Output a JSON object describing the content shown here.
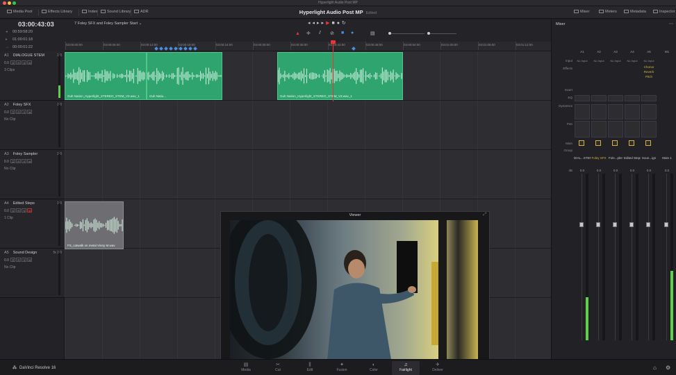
{
  "window": {
    "title": "Hyperlight Audio Post MP"
  },
  "toolbar": {
    "left_items": [
      {
        "label": "Media Pool",
        "icon": "media-pool-icon"
      },
      {
        "label": "Effects Library",
        "icon": "effects-icon"
      },
      {
        "label": "Index",
        "icon": "index-icon"
      },
      {
        "label": "Sound Library",
        "icon": "sound-library-icon"
      },
      {
        "label": "ADR",
        "icon": "adr-icon"
      }
    ],
    "project_title": "Hyperlight Audio Post MP",
    "project_status": "Edited",
    "right_items": [
      {
        "label": "Mixer",
        "icon": "mixer-icon"
      },
      {
        "label": "Meters",
        "icon": "meters-icon"
      },
      {
        "label": "Metadata",
        "icon": "metadata-icon"
      },
      {
        "label": "Inspector",
        "icon": "inspector-icon"
      }
    ]
  },
  "timecode": {
    "main": "03:00:43:03",
    "rows": [
      {
        "label": "IN",
        "value": "00:59:58:20"
      },
      {
        "label": "OUT",
        "value": "01:00:01:18"
      },
      {
        "label": "DUR",
        "value": "00:00:01:22"
      }
    ]
  },
  "timeline": {
    "name": "7 Foley SFX and Foley Sampler Start",
    "ruler_ticks": [
      "03:00:00:00",
      "03:00:06:00",
      "03:00:12:00",
      "03:00:18:00",
      "03:00:24:00",
      "03:00:30:00",
      "03:00:36:00",
      "03:00:42:00",
      "03:00:48:00",
      "03:00:54:00",
      "03:01:00:00",
      "03:01:06:00",
      "03:01:12:00"
    ]
  },
  "tracks": [
    {
      "id": "A1",
      "name": "DIALOGUE STEM",
      "volume": "1.0",
      "level": "0.0",
      "clips": "3 Clips"
    },
    {
      "id": "A2",
      "name": "Foley SFX",
      "volume": "1.0",
      "level": "0.0",
      "clips": "No Clip"
    },
    {
      "id": "A3",
      "name": "Foley Sampler",
      "volume": "1.0",
      "level": "0.0",
      "clips": "No Clip"
    },
    {
      "id": "A4",
      "name": "Edited Steps",
      "volume": "1.0",
      "level": "0.0",
      "clips": "1 Clip"
    },
    {
      "id": "A5",
      "name": "Sound Design",
      "fx": "fx",
      "volume": "1.0",
      "level": "0.0",
      "clips": "No Clip"
    }
  ],
  "clips": {
    "a1_1": "Guh Nation_Hyperlight_STEREO_STEM_V3.wav_1",
    "a1_2": "Guh Natio...",
    "a1_3": "Guh Nation_Hyperlight_STEREO_STEM_V3.wav_1",
    "a4_1": "FS_catwalk on metal Vinny M.wav"
  },
  "viewer": {
    "title": "Viewer"
  },
  "mixer": {
    "title": "Mixer",
    "columns": [
      "A1",
      "A2",
      "A3",
      "A4",
      "A5",
      "M1"
    ],
    "input_values": [
      "No Input",
      "No Input",
      "No Input",
      "No Input",
      "No Input"
    ],
    "effects_a5": [
      "Chorus",
      "Reverb",
      "Pitch"
    ],
    "row_labels": [
      "Input",
      "Effects",
      "Insert",
      "EQ",
      "Dynamics",
      "Pan",
      "Main",
      "Group"
    ],
    "strip_names": [
      "DIAL...STEM",
      "Foley SFX",
      "Fole...pler",
      "Edited Steps",
      "Soun...ign",
      "Main 1"
    ],
    "levels": [
      "0.0",
      "0.0",
      "0.0",
      "0.0",
      "0.0",
      "0.0"
    ],
    "bus_label": "dB"
  },
  "pages": [
    {
      "label": "Media",
      "icon": "media-page-icon"
    },
    {
      "label": "Cut",
      "icon": "cut-page-icon"
    },
    {
      "label": "Edit",
      "icon": "edit-page-icon"
    },
    {
      "label": "Fusion",
      "icon": "fusion-page-icon"
    },
    {
      "label": "Color",
      "icon": "color-page-icon"
    },
    {
      "label": "Fairlight",
      "icon": "fairlight-page-icon",
      "active": true
    },
    {
      "label": "Deliver",
      "icon": "deliver-page-icon"
    }
  ],
  "brand": {
    "name": "DaVinci Resolve 16"
  },
  "colors": {
    "clip_green": "#2fa46f",
    "playhead": "#e33333",
    "marker_blue": "#4a8fe6",
    "meter_green": "#5fd04a",
    "accent_yellow": "#d4b43a"
  }
}
